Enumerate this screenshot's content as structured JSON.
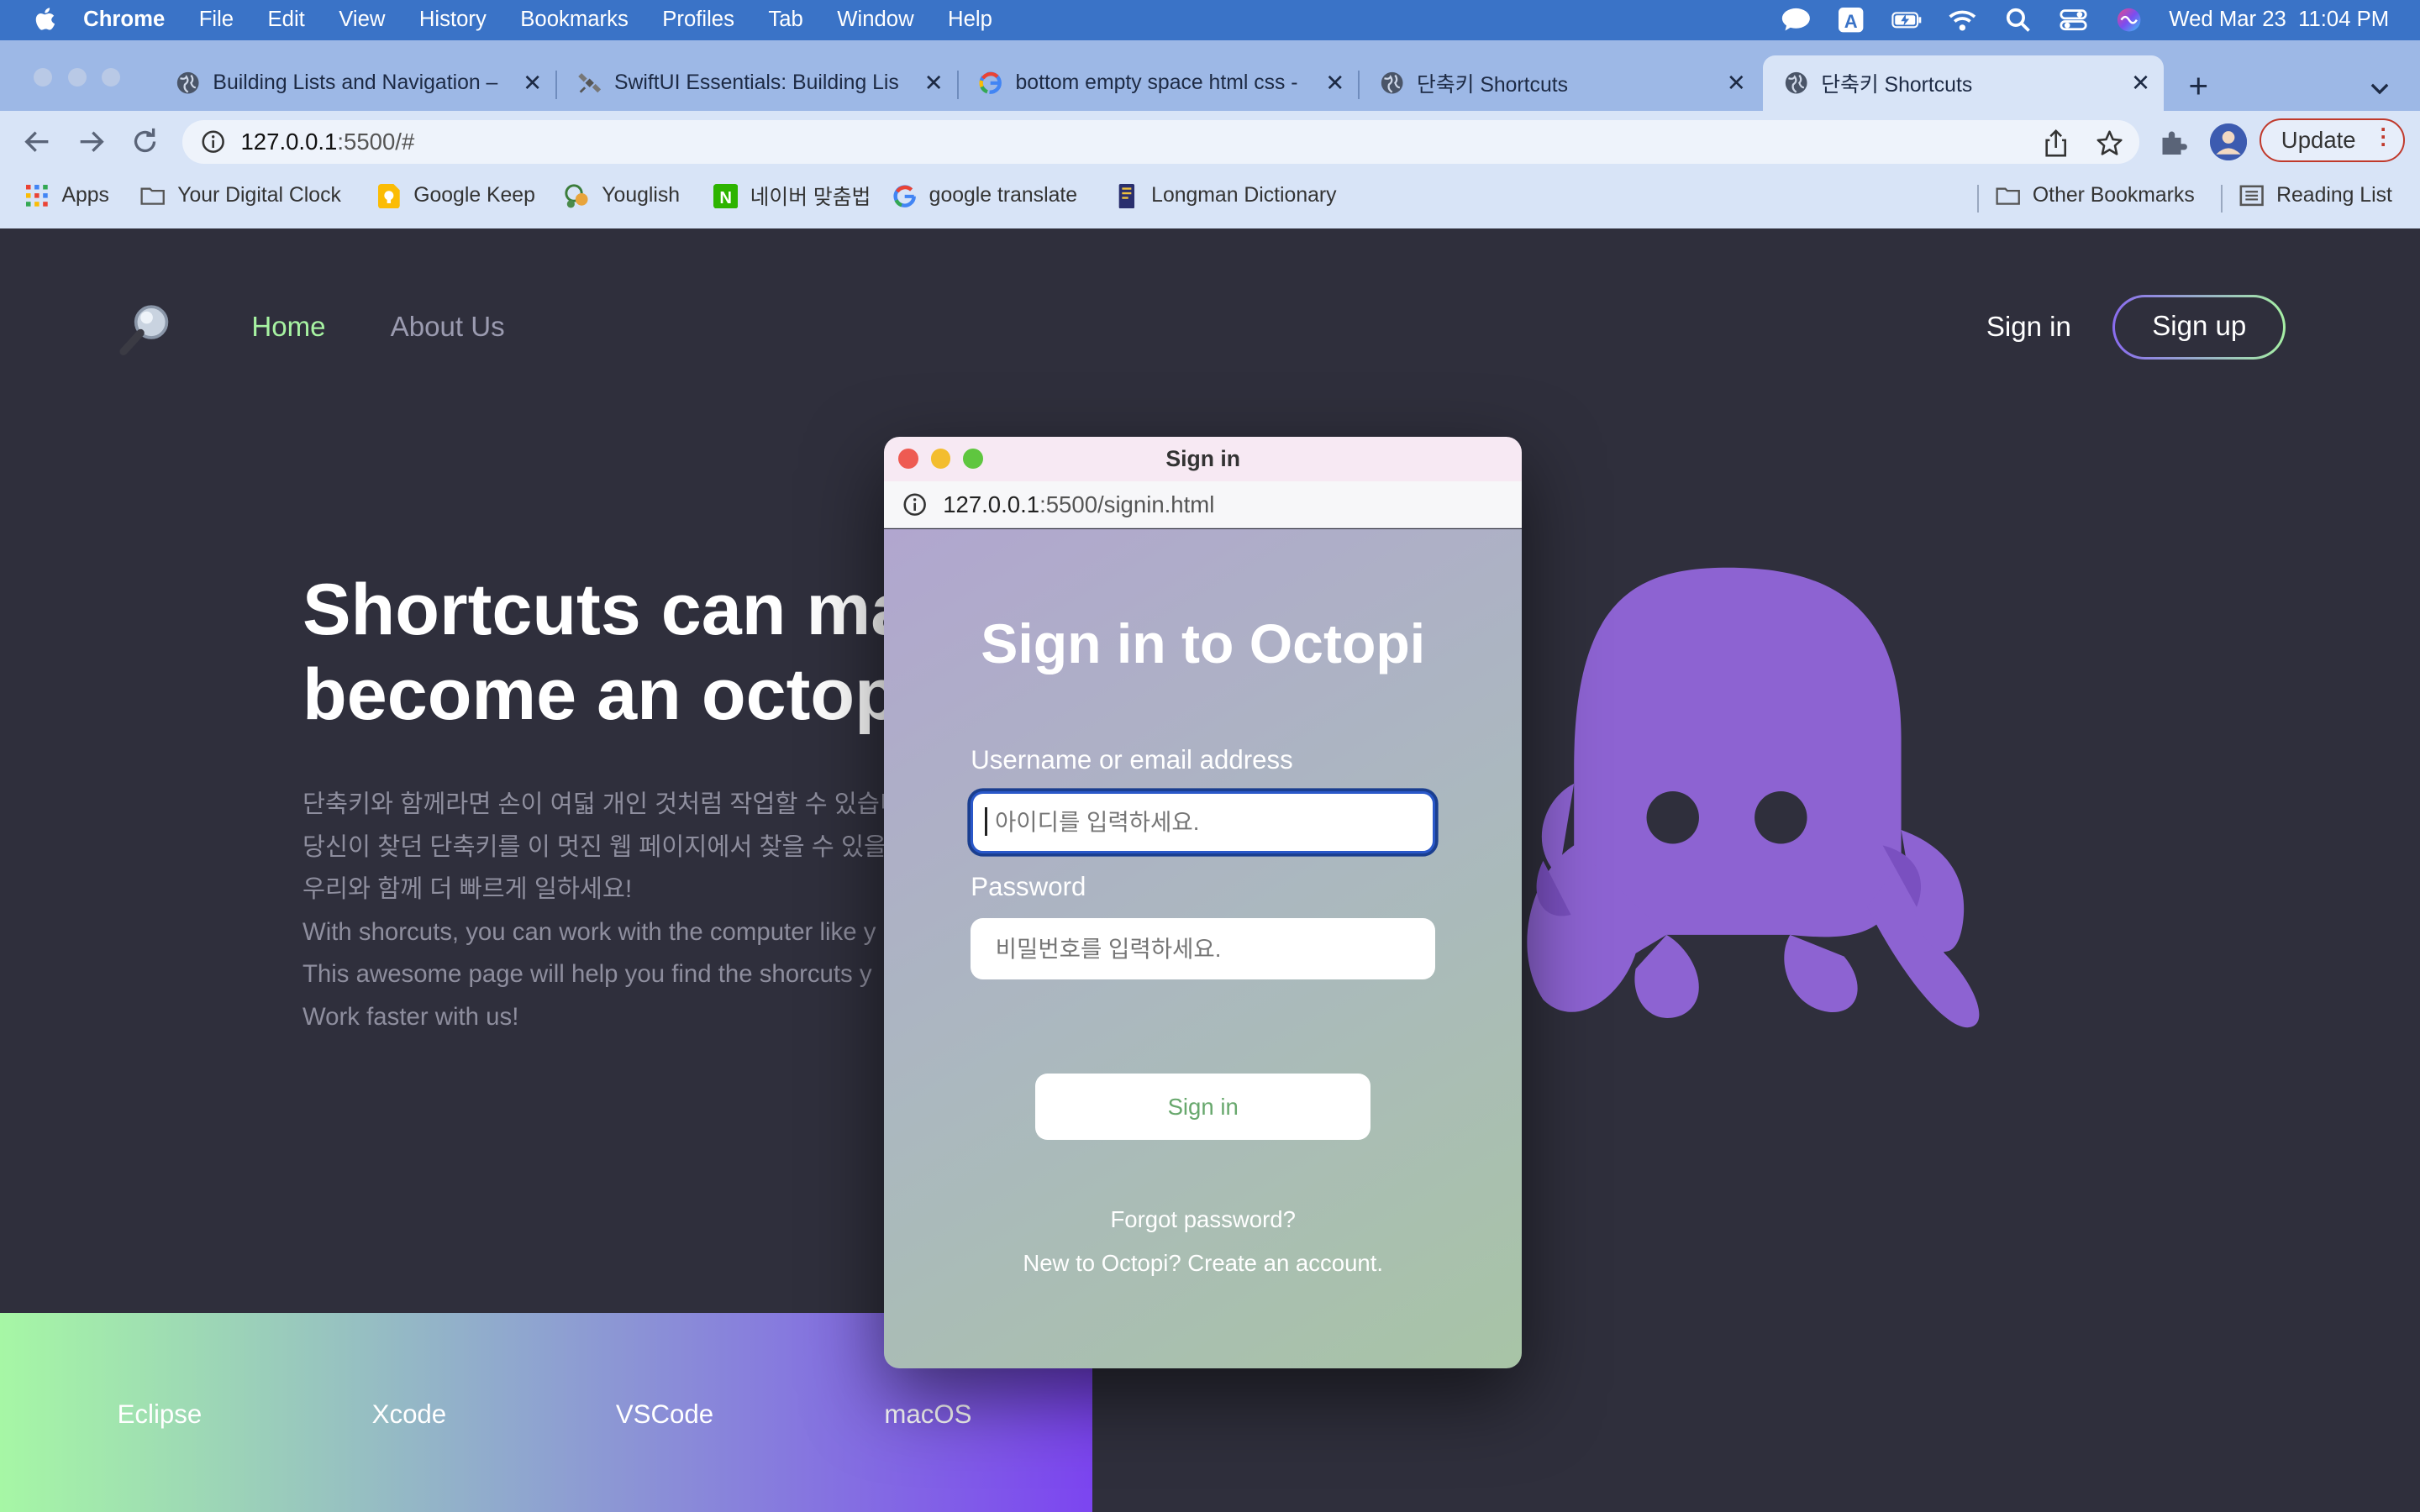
{
  "menubar": {
    "app": "Chrome",
    "items": [
      "File",
      "Edit",
      "View",
      "History",
      "Bookmarks",
      "Profiles",
      "Tab",
      "Window",
      "Help"
    ],
    "clock": "Wed Mar 23  11:04 PM"
  },
  "tabs": [
    {
      "title": "Building Lists and Navigation –",
      "icon": "globe-icon"
    },
    {
      "title": "SwiftUI Essentials: Building Lis",
      "icon": "satellite-icon"
    },
    {
      "title": "bottom empty space html css -",
      "icon": "google-icon"
    },
    {
      "title": "단축키 Shortcuts",
      "icon": "globe-icon"
    },
    {
      "title": "단축키 Shortcuts",
      "icon": "globe-icon",
      "active": true
    }
  ],
  "toolbar": {
    "url_host": "127.0.0.1",
    "url_path": ":5500/#",
    "update_label": "Update"
  },
  "bookmarks": {
    "items": [
      {
        "label": "Apps",
        "icon": "apps-grid-icon"
      },
      {
        "label": "Your Digital Clock",
        "icon": "folder-icon"
      },
      {
        "label": "Google Keep",
        "icon": "keep-icon"
      },
      {
        "label": "Youglish",
        "icon": "youglish-icon"
      },
      {
        "label": "네이버 맞춤법",
        "icon": "naver-icon"
      },
      {
        "label": "google translate",
        "icon": "google-icon"
      },
      {
        "label": "Longman Dictionary",
        "icon": "longman-icon"
      }
    ],
    "other": "Other Bookmarks",
    "reading_list": "Reading List"
  },
  "site": {
    "nav": {
      "home": "Home",
      "about": "About Us",
      "signin": "Sign in",
      "signup": "Sign up"
    },
    "hero_title_1": "Shortcuts can ma",
    "hero_title_2": "become an octop",
    "hero_lines": [
      "단축키와 함께라면 손이 여덟 개인 것처럼 작업할 수 있습니",
      "당신이 찾던 단축키를 이 멋진 웹 페이지에서 찾을 수 있을 것",
      "우리와 함께 더 빠르게 일하세요!",
      "With shorcuts, you can work with the computer like y",
      "This awesome page will help you find the shorcuts y",
      "Work faster with us!"
    ],
    "tools": [
      "Eclipse",
      "Xcode",
      "VSCode",
      "macOS"
    ]
  },
  "popup": {
    "window_title": "Sign in",
    "url_host": "127.0.0.1",
    "url_path": ":5500/signin.html",
    "heading": "Sign in to Octopi",
    "username_label": "Username or email address",
    "username_placeholder": "아이디를 입력하세요.",
    "password_label": "Password",
    "password_placeholder": "비밀번호를 입력하세요.",
    "signin_button": "Sign in",
    "forgot": "Forgot password?",
    "create": "New to Octopi? Create an account."
  },
  "colors": {
    "page_bg": "#2f2f3c",
    "nav_active": "#a7f3a2",
    "octopus": "#8d63d2",
    "signin_button_text": "#68a86d"
  }
}
